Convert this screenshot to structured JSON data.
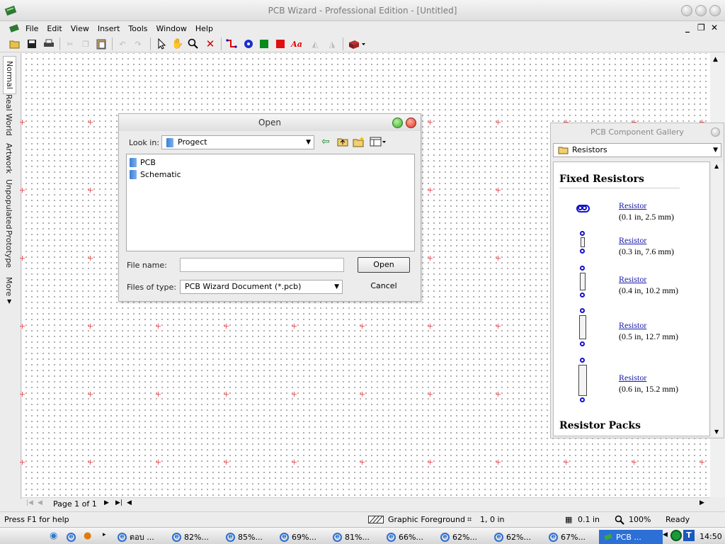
{
  "window": {
    "title": "PCB Wizard - Professional Edition - [Untitled]"
  },
  "menu": {
    "items": [
      "File",
      "Edit",
      "View",
      "Insert",
      "Tools",
      "Window",
      "Help"
    ]
  },
  "left_tabs": [
    "Normal",
    "Real World",
    "Artwork",
    "Unpopulated",
    "Prototype",
    "More"
  ],
  "canvas": {
    "page_label": "Page 1 of 1"
  },
  "dialog": {
    "title": "Open",
    "look_in_label": "Look in:",
    "look_in_value": "Progect",
    "items": [
      "PCB",
      "Schematic"
    ],
    "file_name_label": "File name:",
    "file_name_value": "",
    "files_of_type_label": "Files of type:",
    "files_of_type_value": "PCB Wizard Document (*.pcb)",
    "open_button": "Open",
    "cancel_button": "Cancel"
  },
  "gallery": {
    "title": "PCB Component Gallery",
    "category": "Resistors",
    "section1": "Fixed Resistors",
    "section2": "Resistor Packs",
    "resistors": [
      {
        "link": "Resistor",
        "size": "(0.1 in, 2.5 mm)"
      },
      {
        "link": "Resistor",
        "size": "(0.3 in, 7.6 mm)"
      },
      {
        "link": "Resistor",
        "size": "(0.4 in, 10.2 mm)"
      },
      {
        "link": "Resistor",
        "size": "(0.5 in, 12.7 mm)"
      },
      {
        "link": "Resistor",
        "size": "(0.6 in, 15.2 mm)"
      }
    ]
  },
  "status": {
    "help": "Press F1 for help",
    "layer": "Graphic Foreground",
    "coords": "1, 0 in",
    "grid": "0.1 in",
    "zoom": "100%",
    "state": "Ready"
  },
  "taskbar": {
    "tasks": [
      "ตอบ ...",
      "82%...",
      "85%...",
      "69%...",
      "81%...",
      "66%...",
      "62%...",
      "62%...",
      "67%..."
    ],
    "active_task": "PCB ...",
    "clock": "14:50"
  },
  "colors": {
    "accent": "#2c6fd6",
    "grid_cross": "#ea5c5c",
    "link": "#1a1aa8"
  }
}
